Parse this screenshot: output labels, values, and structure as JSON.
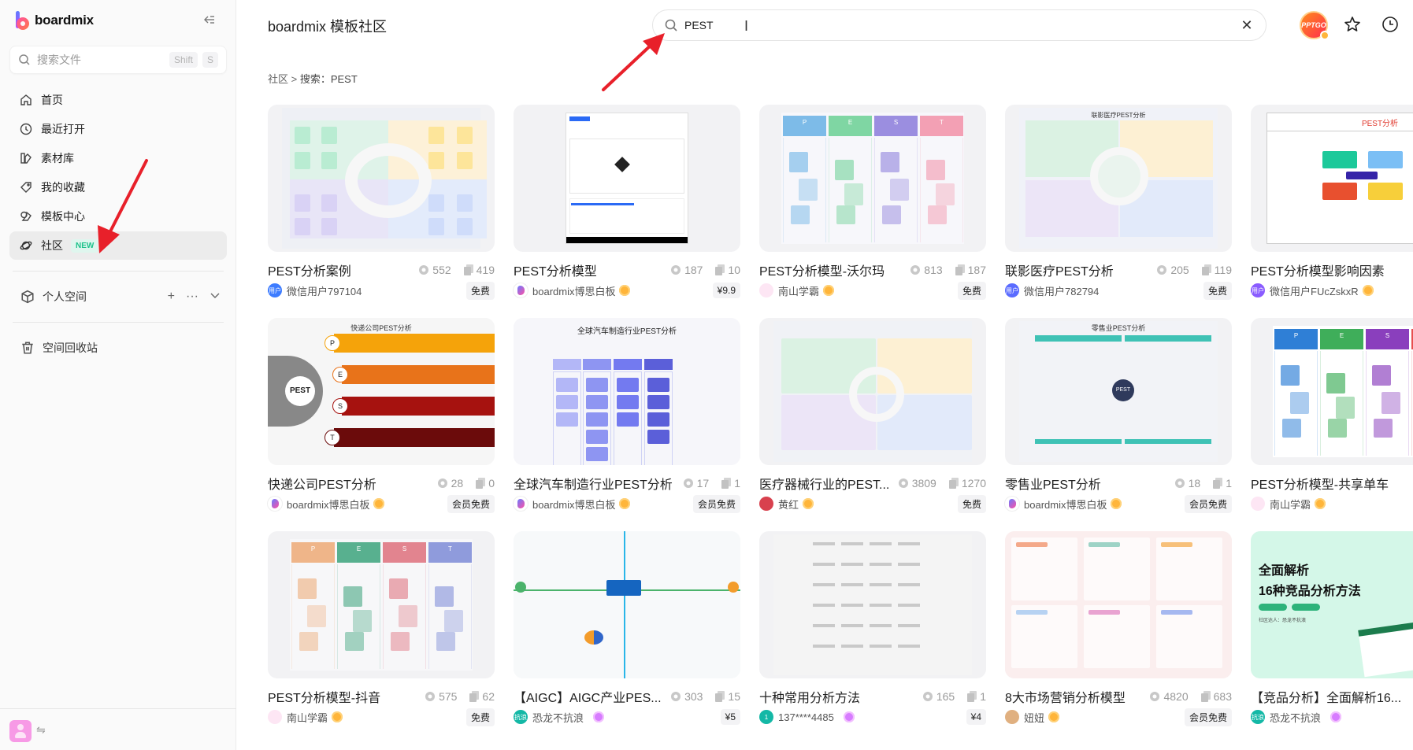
{
  "sidebar": {
    "brand": "boardmix",
    "search_placeholder": "搜索文件",
    "search_shortcut": [
      "Shift",
      "S"
    ],
    "nav": [
      {
        "label": "首页",
        "icon": "home-icon"
      },
      {
        "label": "最近打开",
        "icon": "clock-icon"
      },
      {
        "label": "素材库",
        "icon": "library-icon"
      },
      {
        "label": "我的收藏",
        "icon": "tag-icon"
      },
      {
        "label": "模板中心",
        "icon": "template-icon"
      },
      {
        "label": "社区",
        "icon": "planet-icon",
        "badge": "NEW",
        "active": true
      }
    ],
    "personal_space": "个人空间",
    "trash": "空间回收站"
  },
  "header": {
    "title": "boardmix 模板社区",
    "search_value": "PEST",
    "avatar_text": "PPTGO"
  },
  "breadcrumb": {
    "root": "社区",
    "sep": " > ",
    "current": "搜索：PEST"
  },
  "cards": [
    {
      "title": "PEST分析案例",
      "views": "552",
      "copies": "419",
      "author": "微信用户797104",
      "author_type": "user-blue",
      "level": "",
      "price": "免费"
    },
    {
      "title": "PEST分析模型",
      "views": "187",
      "copies": "10",
      "author": "boardmix博思白板",
      "author_type": "boardmix",
      "level": "gold",
      "price": "¥9.9"
    },
    {
      "title": "PEST分析模型-沃尔玛",
      "views": "813",
      "copies": "187",
      "author": "南山学霸",
      "author_type": "flower",
      "level": "gold",
      "price": "免费"
    },
    {
      "title": "联影医疗PEST分析",
      "views": "205",
      "copies": "119",
      "author": "微信用户782794",
      "author_type": "user-indigo",
      "level": "",
      "price": "免费"
    },
    {
      "title": "PEST分析模型影响因素",
      "views": "",
      "copies": "",
      "author": "微信用户FUcZskxR",
      "author_type": "user-purple",
      "level": "gold",
      "price": ""
    },
    {
      "title": "快递公司PEST分析",
      "views": "28",
      "copies": "0",
      "author": "boardmix博思白板",
      "author_type": "boardmix",
      "level": "gold",
      "price": "会员免费"
    },
    {
      "title": "全球汽车制造行业PEST分析",
      "views": "17",
      "copies": "1",
      "author": "boardmix博思白板",
      "author_type": "boardmix",
      "level": "gold",
      "price": "会员免费"
    },
    {
      "title": "医疗器械行业的PEST...",
      "views": "3809",
      "copies": "1270",
      "author": "黄红",
      "author_type": "photo-red",
      "level": "gold",
      "price": "免费"
    },
    {
      "title": "零售业PEST分析",
      "views": "18",
      "copies": "1",
      "author": "boardmix博思白板",
      "author_type": "boardmix",
      "level": "gold",
      "price": "会员免费"
    },
    {
      "title": "PEST分析模型-共享单车",
      "views": "",
      "copies": "",
      "author": "南山学霸",
      "author_type": "flower",
      "level": "gold",
      "price": ""
    },
    {
      "title": "PEST分析模型-抖音",
      "views": "575",
      "copies": "62",
      "author": "南山学霸",
      "author_type": "flower",
      "level": "gold",
      "price": "免费"
    },
    {
      "title": "【AIGC】AIGC产业PES...",
      "views": "303",
      "copies": "15",
      "author": "恐龙不抗浪",
      "author_type": "teal",
      "level": "purple",
      "price": "¥5"
    },
    {
      "title": "十种常用分析方法",
      "views": "165",
      "copies": "1",
      "author": "137****4485",
      "author_type": "teal-num",
      "level": "purple",
      "price": "¥4"
    },
    {
      "title": "8大市场营销分析模型",
      "views": "4820",
      "copies": "683",
      "author": "妞妞",
      "author_type": "photo-gold",
      "level": "gold",
      "price": "会员免费"
    },
    {
      "title": "【竞品分析】全面解析16...",
      "views": "",
      "copies": "",
      "author": "恐龙不抗浪",
      "author_type": "teal",
      "level": "purple",
      "price": ""
    }
  ],
  "thumb_texts": {
    "card5_title": "PEST分析",
    "card6_title": "快递公司PEST分析",
    "card6_center": "PEST",
    "card6_letters": [
      "P",
      "E",
      "S",
      "T"
    ],
    "card7_title": "全球汽车制造行业PEST分析",
    "card9_title": "零售业PEST分析",
    "card9_center": "PEST",
    "card4_title": "联影医疗PEST分析",
    "card15_line1": "全面解析",
    "card15_line2": "16种竞品分析方法",
    "card15_by": "社区达人：恐龙不抗浪",
    "pest_letters": [
      "P",
      "E",
      "S",
      "T"
    ]
  },
  "colors": {
    "accent_new": "#1ec28b",
    "annotation_arrow": "#e8202a",
    "pest_p": "#f5a30a",
    "pest_e": "#e8731a",
    "pest_s": "#a6120f",
    "pest_t": "#6b0b0b"
  }
}
